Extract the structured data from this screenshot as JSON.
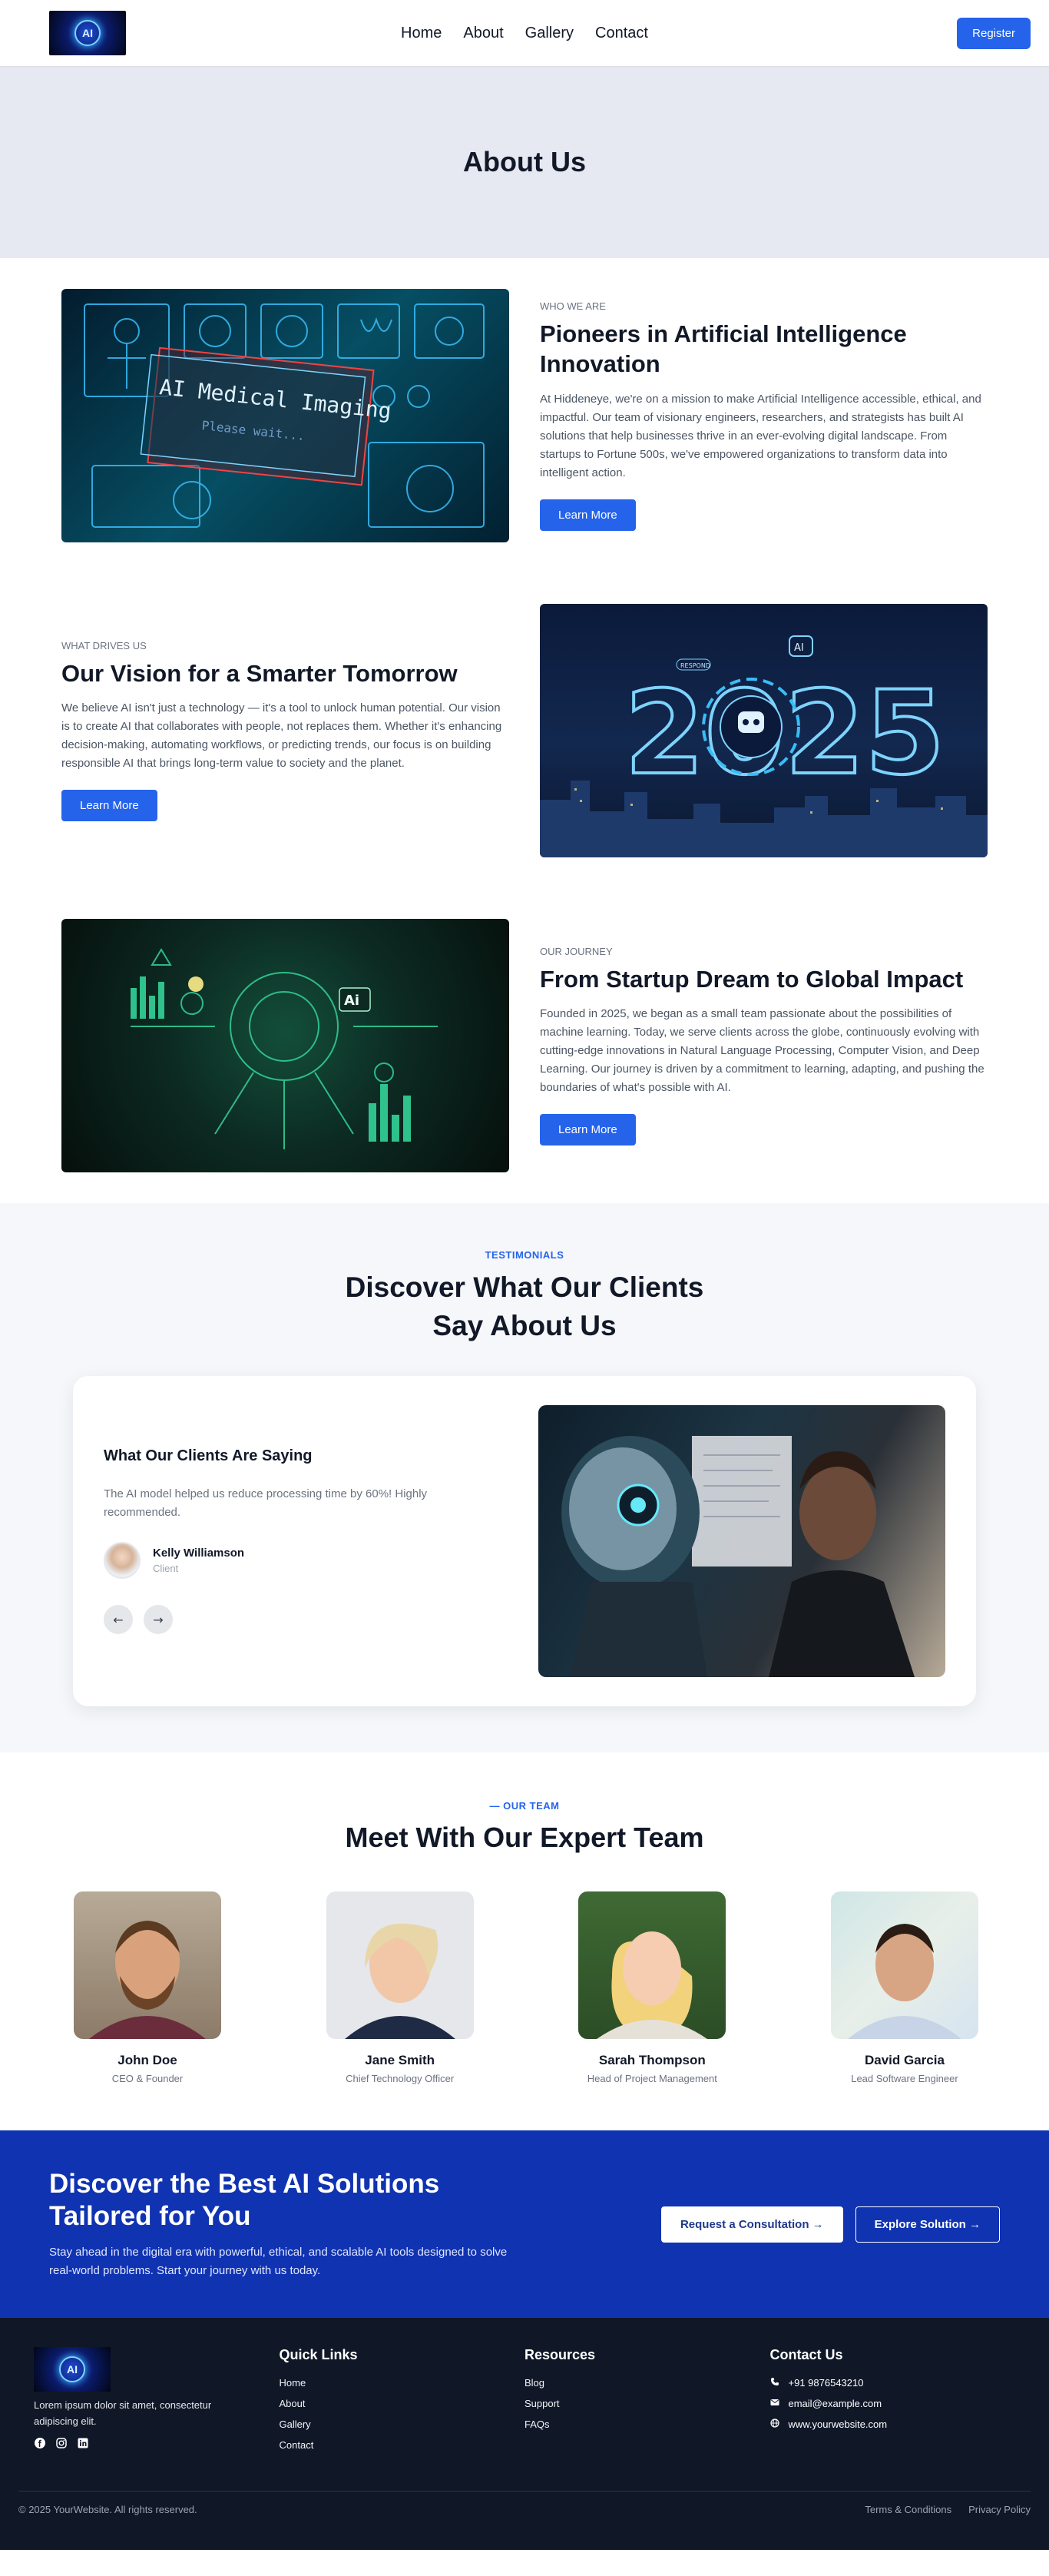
{
  "nav": {
    "logo_text": "AI",
    "links": [
      "Home",
      "About",
      "Gallery",
      "Contact"
    ],
    "register_label": "Register"
  },
  "hero": {
    "title": "About Us"
  },
  "about_blocks": [
    {
      "eyebrow": "WHO WE ARE",
      "title": "Pioneers in Artificial Intelligence Innovation",
      "body": "At Hiddeneye, we're on a mission to make Artificial Intelligence accessible, ethical, and impactful. Our team of visionary engineers, researchers, and strategists has built AI solutions that help businesses thrive in an ever-evolving digital landscape. From startups to Fortune 500s, we've empowered organizations to transform data into intelligent action.",
      "button": "Learn More",
      "image_text": "AI Medical Imaging",
      "image_subtext": "Please wait..."
    },
    {
      "eyebrow": "WHAT DRIVES US",
      "title": "Our Vision for a Smarter Tomorrow",
      "body": "We believe AI isn't just a technology — it's a tool to unlock human potential. Our vision is to create AI that collaborates with people, not replaces them. Whether it's enhancing decision-making, automating workflows, or predicting trends, our focus is on building responsible AI that brings long-term value to society and the planet.",
      "button": "Learn More",
      "image_text": "2025",
      "image_badge": "AI",
      "image_tag": "RESPOND"
    },
    {
      "eyebrow": "OUR JOURNEY",
      "title": "From Startup Dream to Global Impact",
      "body": "Founded in 2025, we began as a small team passionate about the possibilities of machine learning. Today, we serve clients across the globe, continuously evolving with cutting-edge innovations in Natural Language Processing, Computer Vision, and Deep Learning. Our journey is driven by a commitment to learning, adapting, and pushing the boundaries of what's possible with AI.",
      "button": "Learn More",
      "image_badge": "Ai"
    }
  ],
  "testimonials": {
    "eyebrow": "TESTIMONIALS",
    "title_line1": "Discover What Our Clients",
    "title_line2": "Say About Us",
    "card_title": "What Our Clients Are Saying",
    "quote": "The AI model helped us reduce processing time by 60%! Highly recommended.",
    "author_name": "Kelly Williamson",
    "author_role": "Client",
    "prev_icon": "←",
    "next_icon": "→"
  },
  "team": {
    "eyebrow": "— OUR TEAM",
    "title": "Meet With Our Expert Team",
    "members": [
      {
        "name": "John Doe",
        "role": "CEO & Founder"
      },
      {
        "name": "Jane Smith",
        "role": "Chief Technology Officer"
      },
      {
        "name": "Sarah Thompson",
        "role": "Head of Project Management"
      },
      {
        "name": "David Garcia",
        "role": "Lead Software Engineer"
      }
    ]
  },
  "cta": {
    "title": "Discover the Best AI Solutions Tailored for You",
    "body": "Stay ahead in the digital era with powerful, ethical, and scalable AI tools designed to solve real-world problems. Start your journey with us today.",
    "primary": "Request a Consultation →",
    "secondary": "Explore Solution →"
  },
  "footer": {
    "logo_text": "AI",
    "about": "Lorem ipsum dolor sit amet, consectetur adipiscing elit.",
    "social_icons": [
      "facebook-icon",
      "instagram-icon",
      "linkedin-icon"
    ],
    "quick_links_title": "Quick Links",
    "quick_links": [
      "Home",
      "About",
      "Gallery",
      "Contact"
    ],
    "resources_title": "Resources",
    "resources": [
      "Blog",
      "Support",
      "FAQs"
    ],
    "contact_title": "Contact Us",
    "phone": "+91 9876543210",
    "email": "email@example.com",
    "website": "www.yourwebsite.com",
    "copyright": "© 2025 YourWebsite. All rights reserved.",
    "terms": "Terms & Conditions",
    "privacy": "Privacy Policy"
  },
  "colors": {
    "primary": "#2563eb",
    "hero_bg": "#e6e8f2",
    "cta_bg": "#1033b2",
    "footer_bg": "#101828"
  }
}
